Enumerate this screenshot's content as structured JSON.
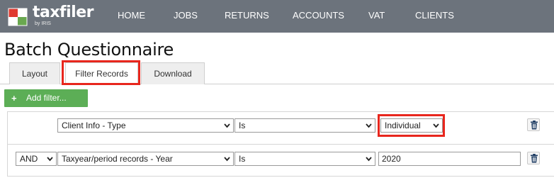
{
  "app": {
    "logo_text": "taxfiler",
    "logo_sub": "by IRIS"
  },
  "nav": {
    "items": [
      {
        "label": "HOME"
      },
      {
        "label": "JOBS"
      },
      {
        "label": "RETURNS"
      },
      {
        "label": "ACCOUNTS"
      },
      {
        "label": "VAT"
      },
      {
        "label": "CLIENTS"
      }
    ]
  },
  "page": {
    "title": "Batch Questionnaire"
  },
  "tabs": [
    {
      "label": "Layout",
      "active": false
    },
    {
      "label": "Filter Records",
      "active": true,
      "highlighted": true
    },
    {
      "label": "Download",
      "active": false
    }
  ],
  "toolbar": {
    "add_filter_label": "Add filter...",
    "add_filter_icon": "+"
  },
  "filters": [
    {
      "connector": "",
      "field": "Client Info - Type",
      "operator": "Is",
      "value": "Individual",
      "value_type": "select",
      "value_highlighted": true
    },
    {
      "connector": "AND",
      "field": "Taxyear/period records - Year",
      "operator": "Is",
      "value": "2020",
      "value_type": "text"
    }
  ],
  "colors": {
    "topbar": "#6c737c",
    "add_button": "#5cae56",
    "highlight": "#e8261d"
  }
}
